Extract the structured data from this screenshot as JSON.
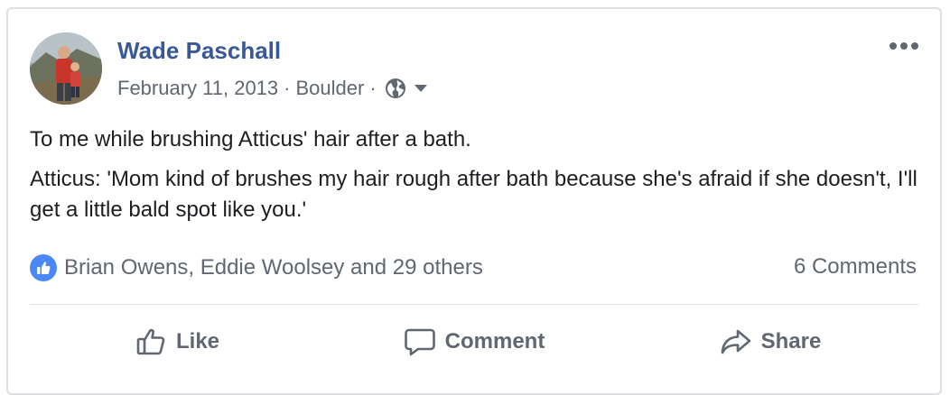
{
  "post": {
    "author": "Wade Paschall",
    "date": "February 11, 2013",
    "separator": "·",
    "location": "Boulder",
    "privacy_icon": "globe-icon",
    "menu_icon": "more-options-icon",
    "paragraphs": [
      "To me while brushing Atticus' hair after a bath.",
      "Atticus: 'Mom kind of brushes my hair rough after bath because she's afraid if she doesn't, I'll get a little bald spot like you.'"
    ],
    "reactions_text": "Brian Owens, Eddie Woolsey and 29 others",
    "reaction_icon": "like-reaction-icon",
    "comments_text": "6 Comments"
  },
  "actions": {
    "like": "Like",
    "comment": "Comment",
    "share": "Share"
  },
  "colors": {
    "author_link": "#385898",
    "secondary_text": "#606770",
    "body_text": "#1c1e21",
    "like_badge": "#4b88f7",
    "border": "#dddfe2"
  }
}
